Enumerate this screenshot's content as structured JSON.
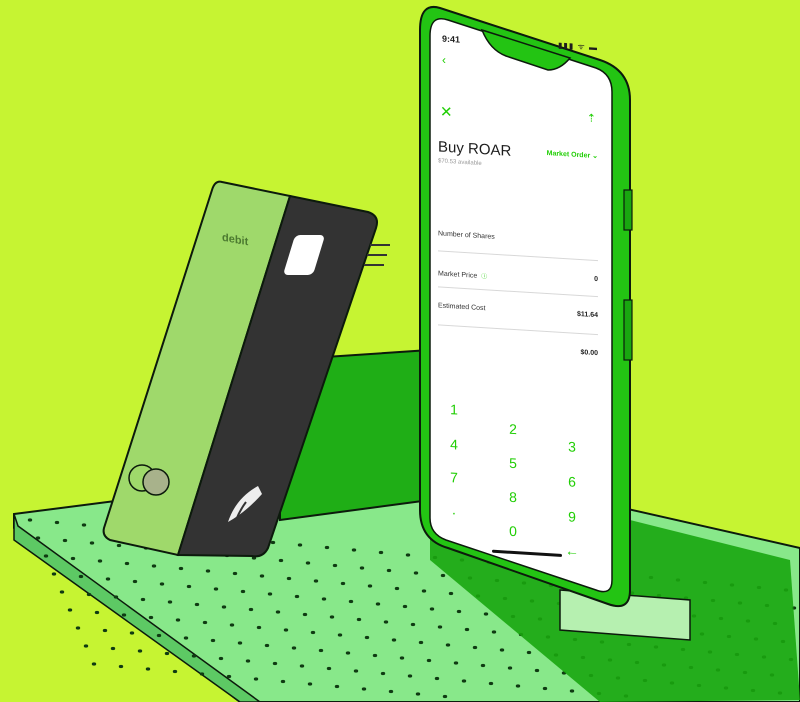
{
  "colors": {
    "background": "#c6f432",
    "accent": "#21ce05",
    "card": "#333333"
  },
  "card": {
    "label": "debit",
    "brand_icon": "mastercard-icon",
    "logo_icon": "feather-icon"
  },
  "phone": {
    "status_time": "9:41",
    "status_icons": "▮▮▮ ᯤ ▬",
    "back_icon": "‹",
    "close_icon": "✕",
    "share_icon": "⇡",
    "title": "Buy ROAR",
    "available": "$70.53 available",
    "order_type": "Market Order ⌄",
    "rows": {
      "shares_label": "Number of Shares",
      "shares_value": "0",
      "price_label": "Market Price",
      "price_info_icon": "ⓘ",
      "price_value": "$11.64",
      "cost_label": "Estimated Cost",
      "cost_value": "$0.00"
    },
    "keypad": {
      "k1": "1",
      "k2": "2",
      "k3": "3",
      "k4": "4",
      "k5": "5",
      "k6": "6",
      "k7": "7",
      "k8": "8",
      "k9": "9",
      "dot": ".",
      "k0": "0",
      "backspace": "←"
    }
  }
}
